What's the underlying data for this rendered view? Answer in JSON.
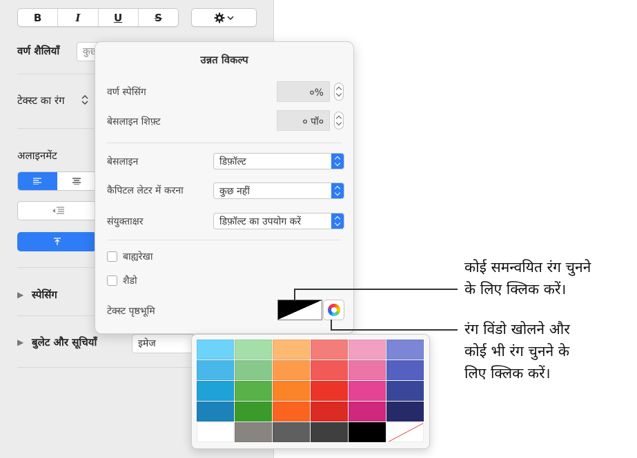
{
  "toolbar": {
    "bold": "B",
    "italic": "I",
    "underline": "U",
    "strike": "S"
  },
  "sidebar": {
    "char_styles_label": "वर्ण शैलियाँ",
    "char_styles_value": "कुछ",
    "text_color_label": "टेक्स्ट का रंग",
    "alignment_label": "अलाइनमेंट",
    "spacing_label": "स्पेसिंग",
    "bullets_label": "बुलेट और सूचियाँ",
    "bullets_value": "इमेज"
  },
  "popover": {
    "title": "उन्नत विकल्प",
    "char_spacing_label": "वर्ण स्पेसिंग",
    "char_spacing_value": "०%",
    "baseline_shift_label": "बेसलाइन शिफ़्ट",
    "baseline_shift_value": "० पॉ०",
    "baseline_label": "बेसलाइन",
    "baseline_value": "डिफ़ॉल्ट",
    "capitals_label": "कैपिटल लेटर में करना",
    "capitals_value": "कुछ नहीं",
    "ligatures_label": "संयुक्ताक्षर",
    "ligatures_value": "डिफ़ॉल्ट का उपयोग करें",
    "outline_label": "बाह्यरेखा",
    "shadow_label": "शैडो",
    "text_bg_label": "टेक्स्ट पृष्ठभूमि"
  },
  "palette": {
    "colors": [
      "#6dd3fb",
      "#a4dea8",
      "#fdb871",
      "#f47d7a",
      "#f2a0c2",
      "#7c86d6",
      "#48b7e9",
      "#86c98b",
      "#fd9b4a",
      "#f25a58",
      "#ed74a7",
      "#5461c0",
      "#1ea2d8",
      "#58b149",
      "#fb8328",
      "#ec3429",
      "#e54394",
      "#38479a",
      "#1b82ba",
      "#3a9b2a",
      "#fa641f",
      "#dc2b22",
      "#d0287c",
      "#262a68",
      "#ffffff",
      "#888480",
      "#5f5f5f",
      "#3f3f3f",
      "#000000",
      "none"
    ]
  },
  "callouts": {
    "swatch_line1": "कोई समन्वयित रंग चुनने",
    "swatch_line2": "के लिए क्लिक करें।",
    "wheel_line1": "रंग विंडो खोलने और",
    "wheel_line2": "कोई भी रंग चुनने के",
    "wheel_line3": "लिए क्लिक करें।"
  }
}
